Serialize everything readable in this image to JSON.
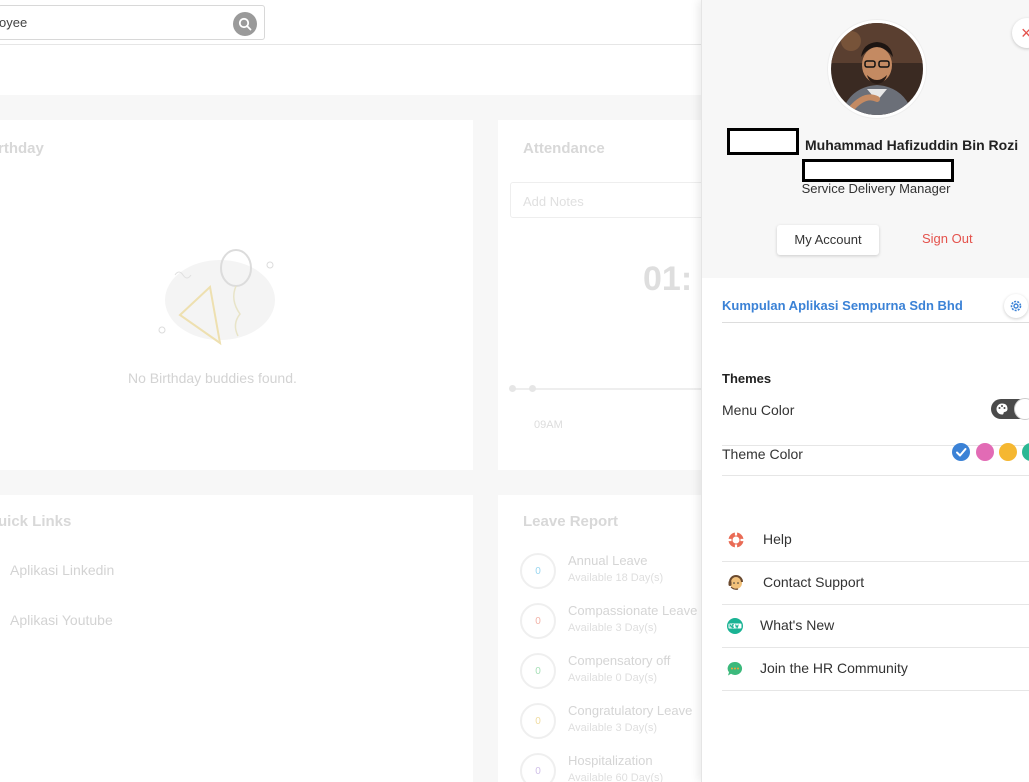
{
  "search": {
    "value": "oyee"
  },
  "dashboard": {
    "birthday": {
      "title": "rthday",
      "empty_text": "No Birthday buddies found."
    },
    "attendance": {
      "title": "Attendance",
      "notes_placeholder": "Add Notes",
      "clock": "01:",
      "time_label": "09AM"
    },
    "quick_links": {
      "title": "uick Links",
      "links": [
        "Aplikasi Linkedin",
        "Aplikasi Youtube"
      ]
    },
    "leave_report": {
      "title": "Leave Report",
      "items": [
        {
          "count": "0",
          "name": "Annual Leave",
          "sub": "Available 18 Day(s)",
          "color": "#9ad6f0"
        },
        {
          "count": "0",
          "name": "Compassionate Leave",
          "sub": "Available 3 Day(s)",
          "color": "#f2b3a8"
        },
        {
          "count": "0",
          "name": "Compensatory off",
          "sub": "Available 0 Day(s)",
          "color": "#a8e0b8"
        },
        {
          "count": "0",
          "name": "Congratulatory Leave",
          "sub": "Available 3 Day(s)",
          "color": "#f0dca0"
        },
        {
          "count": "0",
          "name": "Hospitalization",
          "sub": "Available 60 Day(s)",
          "color": "#d0c0e8"
        }
      ]
    }
  },
  "profile": {
    "name": "Muhammad Hafizuddin Bin Rozi",
    "role": "Service Delivery Manager",
    "my_account_label": "My Account",
    "sign_out_label": "Sign Out",
    "close_glyph": "×"
  },
  "company": {
    "name": "Kumpulan Aplikasi Sempurna Sdn Bhd"
  },
  "themes": {
    "title": "Themes",
    "menu_color_label": "Menu Color",
    "theme_color_label": "Theme Color",
    "colors": [
      "#3b82d6",
      "#e26bb5",
      "#f5b731",
      "#2bb894"
    ],
    "selected_color": "#3b82d6"
  },
  "menu": [
    {
      "label": "Help",
      "icon": "lifebuoy-icon"
    },
    {
      "label": "Contact Support",
      "icon": "support-agent-icon"
    },
    {
      "label": "What's New",
      "icon": "new-badge-icon"
    },
    {
      "label": "Join the HR Community",
      "icon": "chat-bubble-icon"
    }
  ]
}
